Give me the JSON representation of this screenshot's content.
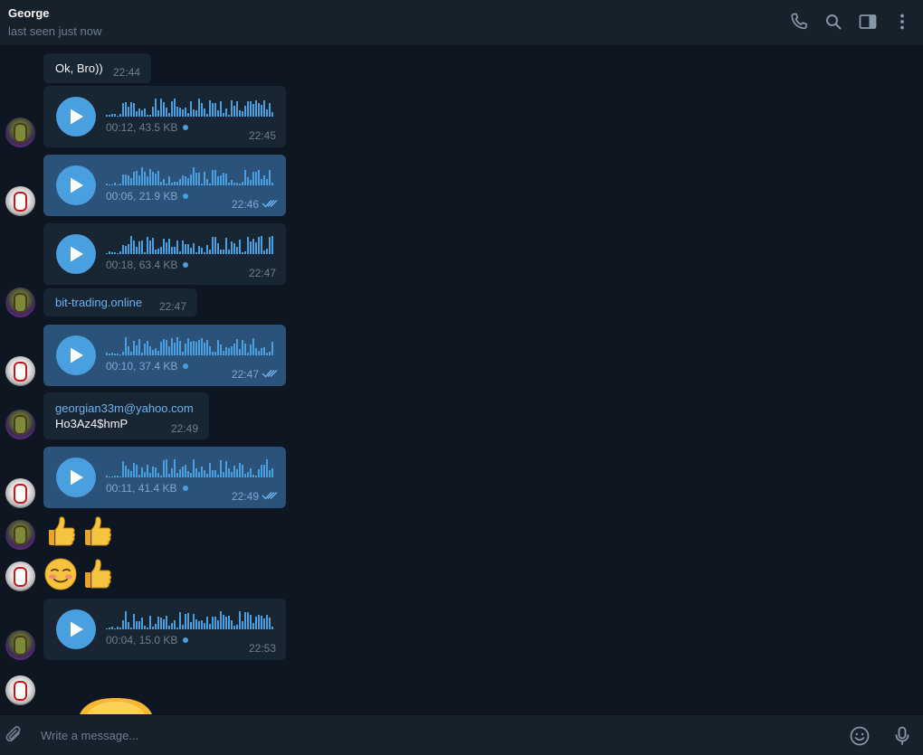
{
  "header": {
    "contact_name": "George",
    "status": "last seen just now",
    "icons": [
      "phone-icon",
      "search-icon",
      "sidebar-toggle-icon",
      "more-vertical-icon"
    ]
  },
  "messages": [
    {
      "type": "text",
      "direction": "in",
      "text": "Ok, Bro))",
      "time": "22:44"
    },
    {
      "type": "voice",
      "direction": "in",
      "meta": "00:12, 43.5 KB",
      "time": "22:45"
    },
    {
      "type": "voice",
      "direction": "out",
      "meta": "00:06, 21.9 KB",
      "time": "22:46",
      "read": true
    },
    {
      "type": "voice",
      "direction": "out",
      "meta": "00:18, 63.4 KB",
      "time": "22:47"
    },
    {
      "type": "link",
      "direction": "in",
      "text": "bit-trading.online",
      "time": "22:47"
    },
    {
      "type": "voice",
      "direction": "out",
      "meta": "00:10, 37.4 KB",
      "time": "22:47",
      "read": true
    },
    {
      "type": "text2",
      "direction": "in",
      "link": "georgian33m@yahoo.com",
      "text": "Ho3Az4$hmP",
      "time": "22:49"
    },
    {
      "type": "voice",
      "direction": "out",
      "meta": "00:11, 41.4 KB",
      "time": "22:49",
      "read": true
    },
    {
      "type": "emoji",
      "direction": "in",
      "emoji": [
        "thumbs-up",
        "thumbs-up"
      ]
    },
    {
      "type": "emoji",
      "direction": "out",
      "emoji": [
        "smiling-face",
        "thumbs-up"
      ]
    },
    {
      "type": "voice",
      "direction": "in",
      "meta": "00:04, 15.0 KB",
      "time": "22:53"
    }
  ],
  "composer": {
    "placeholder": "Write a message...",
    "icons": [
      "paperclip-icon",
      "emoji-icon",
      "microphone-icon"
    ]
  },
  "colors": {
    "background": "#0e1621",
    "header": "#17212b",
    "incoming_bubble": "#182533",
    "outgoing_bubble": "#2b5278",
    "accent": "#4a9fe0",
    "link": "#6ab3f3",
    "muted": "#6d7f8f"
  }
}
